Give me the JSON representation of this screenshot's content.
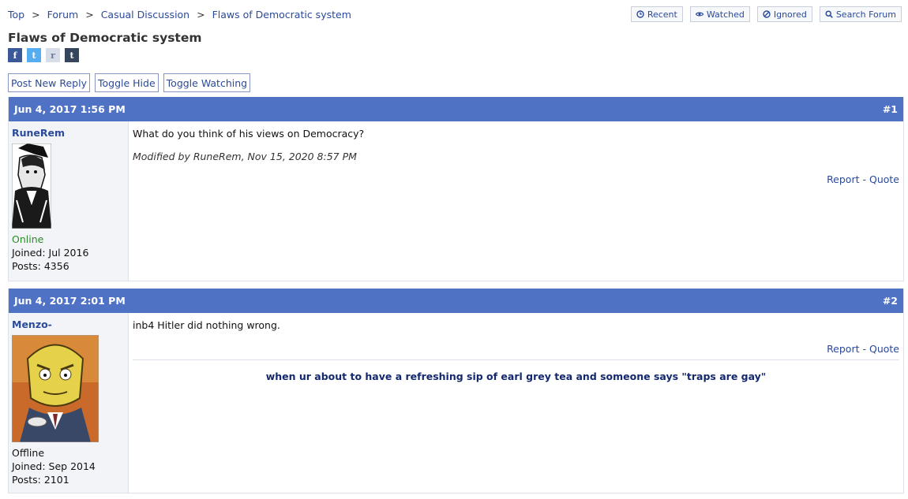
{
  "breadcrumb": [
    "Top",
    "Forum",
    "Casual Discussion",
    "Flaws of Democratic system"
  ],
  "breadcrumb_sep": ">",
  "top_buttons": [
    {
      "label": "Recent",
      "icon": "clock-icon"
    },
    {
      "label": "Watched",
      "icon": "eye-icon"
    },
    {
      "label": "Ignored",
      "icon": "ban-icon"
    },
    {
      "label": "Search Forum",
      "icon": "search-icon"
    }
  ],
  "thread_title": "Flaws of Democratic system",
  "share": [
    {
      "glyph": "f",
      "icon": "facebook-icon"
    },
    {
      "glyph": "t",
      "icon": "twitter-icon"
    },
    {
      "glyph": "r",
      "icon": "reddit-icon"
    },
    {
      "glyph": "t",
      "icon": "tumblr-icon"
    }
  ],
  "actions": [
    "Post New Reply",
    "Toggle Hide",
    "Toggle Watching"
  ],
  "posts": [
    {
      "date": "Jun 4, 2017 1:56 PM",
      "number": "#1",
      "user": "RuneRem",
      "status": "Online",
      "joined": "Joined: Jul 2016",
      "posts": "Posts: 4356",
      "message": "What do you think of his views on Democracy?",
      "modified": "Modified by RuneRem, Nov 15, 2020 8:57 PM",
      "report": "Report",
      "quote": "Quote"
    },
    {
      "date": "Jun 4, 2017 2:01 PM",
      "number": "#2",
      "user": "Menzo-",
      "status": "Offline",
      "joined": "Joined: Sep 2014",
      "posts": "Posts: 2101",
      "message": "inb4 Hitler did nothing wrong.",
      "report": "Report",
      "quote": "Quote",
      "signature": "when ur about to have a refreshing sip of earl grey tea and someone says \"traps are gay\""
    }
  ],
  "link_dash": "-",
  "colors": {
    "header_bar": "#4f72c4",
    "link": "#2a4a9a",
    "online": "#2a8a2a",
    "signature": "#13286e"
  }
}
